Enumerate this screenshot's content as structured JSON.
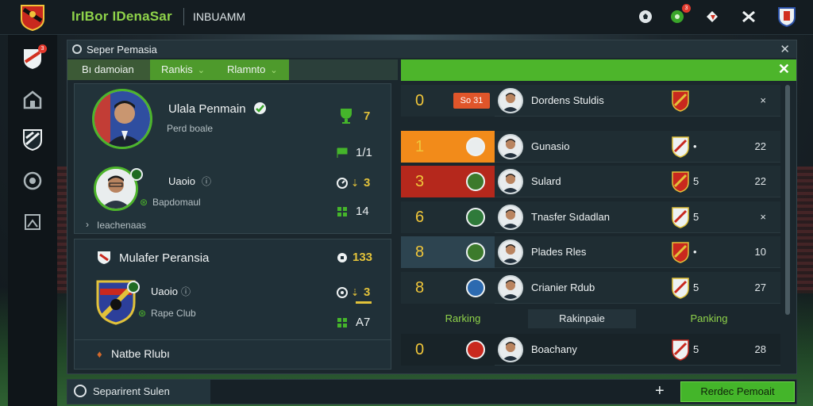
{
  "header": {
    "app_title": "IrIBor IDenaSar",
    "app_subtitle": "INBUAMM"
  },
  "panel": {
    "title": "Seper Pemasia",
    "close": "✕",
    "tabs": [
      {
        "label": "Bı damoian"
      },
      {
        "label": "Rankis",
        "chevron": "⌄"
      },
      {
        "label": "Rlamnto",
        "chevron": "⌄"
      }
    ],
    "greenbar_close": "✕"
  },
  "cards": {
    "top": {
      "player1": {
        "name": "Ulala Penmain",
        "sub": "Perd boale"
      },
      "player2": {
        "name": "Uaoio",
        "sub": "Bapdomaul"
      },
      "stats": [
        {
          "value": "7",
          "icon": "trophy-icon"
        },
        {
          "value": "1/1",
          "icon": "flag-icon"
        },
        {
          "value": "3",
          "icon": "gauge-icon"
        },
        {
          "value": "14",
          "icon": "grid-icon"
        }
      ],
      "footer_label": "Ieachenaas",
      "footer_chevron": "›"
    },
    "bottom": {
      "title": "Mulafer Peransia",
      "club_name": "Uaoio",
      "club_sub": "Rape Club",
      "stats": [
        {
          "value": "133"
        },
        {
          "value": "3"
        },
        {
          "value": "A7"
        }
      ],
      "footer_label": "Natbe Rlubı"
    }
  },
  "ranking": {
    "rows": [
      {
        "rank": "0",
        "tag": "So 31",
        "name": "Dordens Stuldis",
        "club_num": "",
        "pts": "×",
        "rank_bg": "#1f2d33"
      },
      {
        "rank": "1",
        "name": "Gunasio",
        "club_num": "•",
        "pts": "22",
        "rank_bg": "#f28b1a"
      },
      {
        "rank": "3",
        "name": "Sulard",
        "club_num": "5",
        "pts": "22",
        "rank_bg": "#b5281c"
      },
      {
        "rank": "6",
        "name": "Tnasfer Sıdadlan",
        "club_num": "5",
        "pts": "×",
        "rank_bg": "#1f2d33"
      },
      {
        "rank": "8",
        "name": "Plades Rles",
        "club_num": "•",
        "pts": "10",
        "rank_bg": "#2d4450"
      },
      {
        "rank": "8",
        "name": "Crianier Rdub",
        "club_num": "5",
        "pts": "27",
        "rank_bg": "#1f2d33"
      }
    ],
    "headers": [
      "Rarking",
      "Rakinpaie",
      "Panking"
    ],
    "current": {
      "rank": "0",
      "name": "Boachany",
      "club_num": "5",
      "pts": "28"
    }
  },
  "footer": {
    "left_label": "Separirent Sulen",
    "plus": "+",
    "button": "Rerdec Pemoait"
  },
  "colors": {
    "accent": "#4db52b",
    "gold": "#f0c63a",
    "panel": "#1b272d"
  }
}
